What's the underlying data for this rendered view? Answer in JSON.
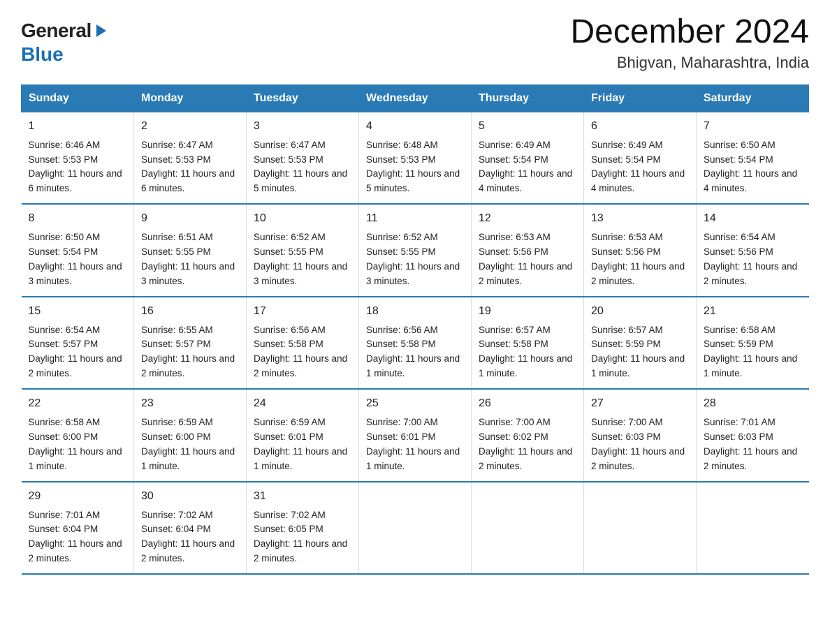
{
  "header": {
    "logo_general": "General",
    "logo_blue": "Blue",
    "title": "December 2024",
    "location": "Bhigvan, Maharashtra, India"
  },
  "days_of_week": [
    "Sunday",
    "Monday",
    "Tuesday",
    "Wednesday",
    "Thursday",
    "Friday",
    "Saturday"
  ],
  "weeks": [
    [
      {
        "day": "1",
        "sunrise": "6:46 AM",
        "sunset": "5:53 PM",
        "daylight": "11 hours and 6 minutes."
      },
      {
        "day": "2",
        "sunrise": "6:47 AM",
        "sunset": "5:53 PM",
        "daylight": "11 hours and 6 minutes."
      },
      {
        "day": "3",
        "sunrise": "6:47 AM",
        "sunset": "5:53 PM",
        "daylight": "11 hours and 5 minutes."
      },
      {
        "day": "4",
        "sunrise": "6:48 AM",
        "sunset": "5:53 PM",
        "daylight": "11 hours and 5 minutes."
      },
      {
        "day": "5",
        "sunrise": "6:49 AM",
        "sunset": "5:54 PM",
        "daylight": "11 hours and 4 minutes."
      },
      {
        "day": "6",
        "sunrise": "6:49 AM",
        "sunset": "5:54 PM",
        "daylight": "11 hours and 4 minutes."
      },
      {
        "day": "7",
        "sunrise": "6:50 AM",
        "sunset": "5:54 PM",
        "daylight": "11 hours and 4 minutes."
      }
    ],
    [
      {
        "day": "8",
        "sunrise": "6:50 AM",
        "sunset": "5:54 PM",
        "daylight": "11 hours and 3 minutes."
      },
      {
        "day": "9",
        "sunrise": "6:51 AM",
        "sunset": "5:55 PM",
        "daylight": "11 hours and 3 minutes."
      },
      {
        "day": "10",
        "sunrise": "6:52 AM",
        "sunset": "5:55 PM",
        "daylight": "11 hours and 3 minutes."
      },
      {
        "day": "11",
        "sunrise": "6:52 AM",
        "sunset": "5:55 PM",
        "daylight": "11 hours and 3 minutes."
      },
      {
        "day": "12",
        "sunrise": "6:53 AM",
        "sunset": "5:56 PM",
        "daylight": "11 hours and 2 minutes."
      },
      {
        "day": "13",
        "sunrise": "6:53 AM",
        "sunset": "5:56 PM",
        "daylight": "11 hours and 2 minutes."
      },
      {
        "day": "14",
        "sunrise": "6:54 AM",
        "sunset": "5:56 PM",
        "daylight": "11 hours and 2 minutes."
      }
    ],
    [
      {
        "day": "15",
        "sunrise": "6:54 AM",
        "sunset": "5:57 PM",
        "daylight": "11 hours and 2 minutes."
      },
      {
        "day": "16",
        "sunrise": "6:55 AM",
        "sunset": "5:57 PM",
        "daylight": "11 hours and 2 minutes."
      },
      {
        "day": "17",
        "sunrise": "6:56 AM",
        "sunset": "5:58 PM",
        "daylight": "11 hours and 2 minutes."
      },
      {
        "day": "18",
        "sunrise": "6:56 AM",
        "sunset": "5:58 PM",
        "daylight": "11 hours and 1 minute."
      },
      {
        "day": "19",
        "sunrise": "6:57 AM",
        "sunset": "5:58 PM",
        "daylight": "11 hours and 1 minute."
      },
      {
        "day": "20",
        "sunrise": "6:57 AM",
        "sunset": "5:59 PM",
        "daylight": "11 hours and 1 minute."
      },
      {
        "day": "21",
        "sunrise": "6:58 AM",
        "sunset": "5:59 PM",
        "daylight": "11 hours and 1 minute."
      }
    ],
    [
      {
        "day": "22",
        "sunrise": "6:58 AM",
        "sunset": "6:00 PM",
        "daylight": "11 hours and 1 minute."
      },
      {
        "day": "23",
        "sunrise": "6:59 AM",
        "sunset": "6:00 PM",
        "daylight": "11 hours and 1 minute."
      },
      {
        "day": "24",
        "sunrise": "6:59 AM",
        "sunset": "6:01 PM",
        "daylight": "11 hours and 1 minute."
      },
      {
        "day": "25",
        "sunrise": "7:00 AM",
        "sunset": "6:01 PM",
        "daylight": "11 hours and 1 minute."
      },
      {
        "day": "26",
        "sunrise": "7:00 AM",
        "sunset": "6:02 PM",
        "daylight": "11 hours and 2 minutes."
      },
      {
        "day": "27",
        "sunrise": "7:00 AM",
        "sunset": "6:03 PM",
        "daylight": "11 hours and 2 minutes."
      },
      {
        "day": "28",
        "sunrise": "7:01 AM",
        "sunset": "6:03 PM",
        "daylight": "11 hours and 2 minutes."
      }
    ],
    [
      {
        "day": "29",
        "sunrise": "7:01 AM",
        "sunset": "6:04 PM",
        "daylight": "11 hours and 2 minutes."
      },
      {
        "day": "30",
        "sunrise": "7:02 AM",
        "sunset": "6:04 PM",
        "daylight": "11 hours and 2 minutes."
      },
      {
        "day": "31",
        "sunrise": "7:02 AM",
        "sunset": "6:05 PM",
        "daylight": "11 hours and 2 minutes."
      },
      null,
      null,
      null,
      null
    ]
  ],
  "labels": {
    "sunrise": "Sunrise:",
    "sunset": "Sunset:",
    "daylight": "Daylight:"
  }
}
